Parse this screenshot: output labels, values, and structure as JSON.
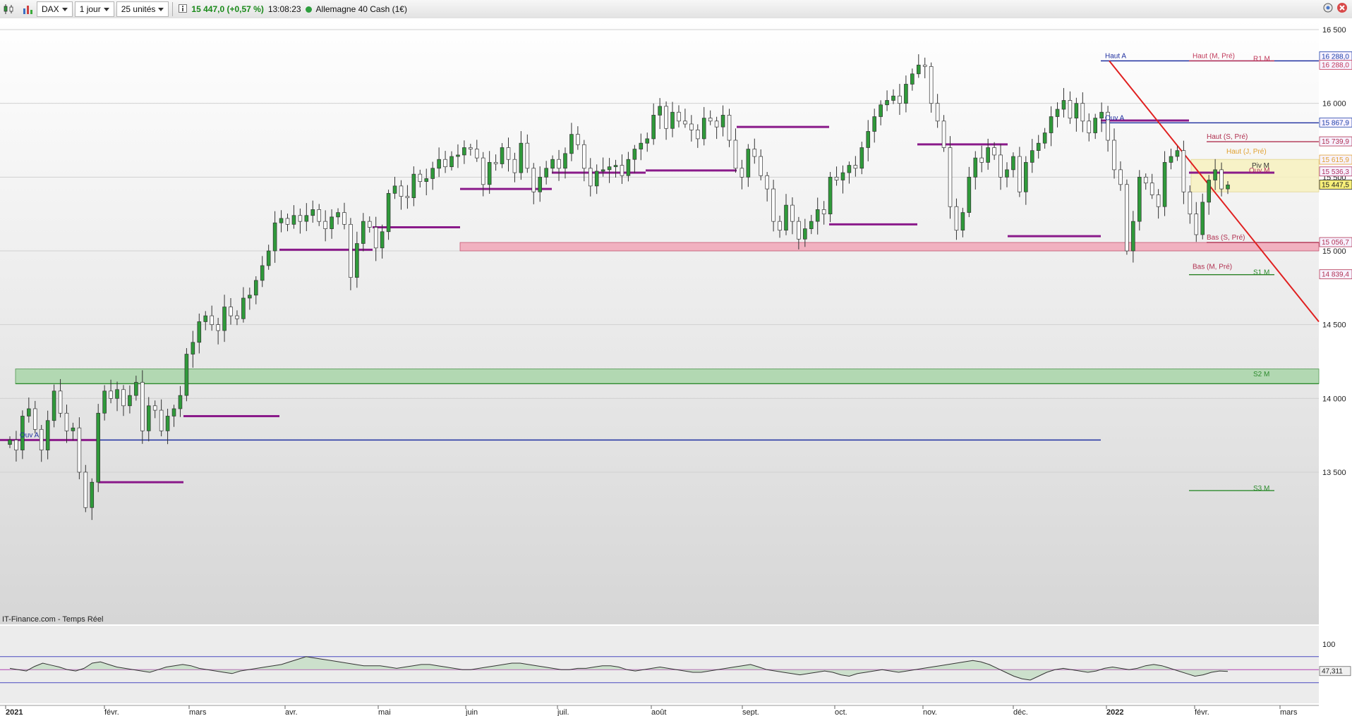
{
  "toolbar": {
    "symbol": "DAX",
    "period": "1 jour",
    "units": "25 unités",
    "quote": "15 447,0 (+0,57 %)",
    "time": "13:08:23",
    "instrument": "Allemagne 40 Cash (1€)",
    "icons": [
      "candlestick-chart-icon",
      "bar-chart-icon",
      "info-icon",
      "live-status-icon",
      "settings-icon",
      "close-icon"
    ]
  },
  "chart_data": [
    {
      "type": "candlestick",
      "ylim": [
        13500,
        16500
      ],
      "y_ticks": [
        "16 500",
        "16 000",
        "15 500",
        "15 000",
        "14 500",
        "14 000",
        "13 500"
      ],
      "x_ticks": [
        "2021",
        "févr.",
        "mars",
        "avr.",
        "mai",
        "juin",
        "juil.",
        "août",
        "sept.",
        "oct.",
        "nov.",
        "déc.",
        "2022",
        "févr.",
        "mars"
      ],
      "price_labels": [
        {
          "text": "16 288,0",
          "color": "#1f3fa8"
        },
        {
          "text": "16 288,0",
          "color": "#c0395a"
        },
        {
          "text": "15 867,9",
          "color": "#1f3fa8"
        },
        {
          "text": "15 739,9",
          "color": "#b03050"
        },
        {
          "text": "15 615,9",
          "color": "#e0a030"
        },
        {
          "text": "15 536,3",
          "color": "#b03060"
        },
        {
          "text": "15 447,5",
          "color": "#222222"
        },
        {
          "text": "15 056,7",
          "color": "#b03050"
        },
        {
          "text": "14 839,4",
          "color": "#b03050"
        }
      ],
      "annotations": [
        "Haut A",
        "Haut (M, Pré)",
        "R1 M",
        "Ouv A",
        "Haut (S, Pré)",
        "Haut (J, Pré)",
        "Piv M",
        "Ouv M",
        "Bas (S, Pré)",
        "Bas (M, Pré)",
        "S1 M",
        "S2 M",
        "S3 M",
        "Ouv A"
      ],
      "levels": [
        {
          "label": "Haut A",
          "value": 16288,
          "color": "#1f2fa0"
        },
        {
          "label": "Ouv A",
          "value": 15868,
          "color": "#1f2fa0"
        },
        {
          "label": "Ouv A 2021",
          "value": 13718,
          "color": "#1f2fa0"
        },
        {
          "label": "Haut (M, Pré)",
          "value": 16288,
          "color": "#c0395a"
        },
        {
          "label": "Haut (S, Pré)",
          "value": 15740,
          "color": "#b03050"
        },
        {
          "label": "Bas (S, Pré)",
          "value": 15057,
          "color": "#b03050"
        },
        {
          "label": "Bas (M, Pré)",
          "value": 14839,
          "color": "#b03050"
        },
        {
          "label": "S1 M",
          "value": 14839,
          "color": "#2e8b2e"
        },
        {
          "label": "S2 M",
          "value": 14100,
          "color": "#2e8b2e"
        },
        {
          "label": "S3 M",
          "value": 13375,
          "color": "#2e8b2e"
        }
      ],
      "zones": [
        {
          "from": 15000,
          "to": 15057,
          "color": "#f2a7b8"
        },
        {
          "from": 14100,
          "to": 14200,
          "color": "#a9d6a9"
        },
        {
          "from": 15400,
          "to": 15620,
          "color": "#f8f2c0"
        }
      ],
      "monthly_opens": [
        13718,
        13432,
        13880,
        15008,
        15160,
        15420,
        15530,
        15545,
        15840,
        15180,
        15722,
        15100,
        15884,
        15530,
        15540
      ],
      "trendline": {
        "from": 16288,
        "to": 14950,
        "color": "#e02020"
      },
      "close_series": [
        13718,
        13650,
        13880,
        13930,
        13790,
        13650,
        13850,
        14050,
        13900,
        13780,
        13800,
        13500,
        13260,
        13432,
        13900,
        14050,
        14000,
        14060,
        13950,
        14020,
        14109,
        13780,
        13950,
        13920,
        13780,
        13880,
        13930,
        14020,
        14300,
        14380,
        14520,
        14560,
        14500,
        14460,
        14620,
        14560,
        14540,
        14680,
        14700,
        14800,
        14900,
        15000,
        15190,
        15220,
        15180,
        15240,
        15200,
        15240,
        15280,
        15200,
        15150,
        15230,
        15260,
        15180,
        14820,
        15050,
        15200,
        15160,
        15020,
        15130,
        15390,
        15440,
        15370,
        15360,
        15520,
        15470,
        15490,
        15560,
        15620,
        15570,
        15640,
        15650,
        15700,
        15690,
        15630,
        15450,
        15600,
        15590,
        15700,
        15620,
        15530,
        15730,
        15560,
        15400,
        15500,
        15560,
        15620,
        15560,
        15660,
        15790,
        15720,
        15560,
        15440,
        15540,
        15550,
        15570,
        15580,
        15510,
        15620,
        15690,
        15730,
        15760,
        15920,
        15980,
        15830,
        15940,
        15880,
        15860,
        15820,
        15760,
        15900,
        15880,
        15840,
        15920,
        15750,
        15560,
        15500,
        15690,
        15640,
        15510,
        15420,
        15200,
        15140,
        15310,
        15200,
        15080,
        15150,
        15200,
        15280,
        15250,
        15500,
        15480,
        15530,
        15580,
        15560,
        15700,
        15810,
        15910,
        15990,
        16020,
        16050,
        16000,
        16130,
        16200,
        16260,
        16250,
        16000,
        15880,
        15700,
        15300,
        15140,
        15260,
        15500,
        15630,
        15600,
        15700,
        15650,
        15500,
        15550,
        15640,
        15400,
        15600,
        15680,
        15730,
        15800,
        15910,
        15960,
        16020,
        15900,
        16000,
        15880,
        15800,
        15900,
        15940,
        15750,
        15550,
        15450,
        15000,
        15200,
        15500,
        15460,
        15380,
        15300,
        15600,
        15640,
        15680,
        15400,
        15250,
        15110,
        15330,
        15480,
        15550,
        15420,
        15447
      ]
    },
    {
      "type": "line",
      "title": "",
      "ylim": [
        0,
        100
      ],
      "y_ticks": [
        "100"
      ],
      "value_label": "47,311",
      "reference_levels": [
        30,
        50,
        70
      ],
      "values": [
        52,
        50,
        48,
        55,
        60,
        57,
        54,
        50,
        48,
        52,
        60,
        62,
        58,
        54,
        52,
        50,
        48,
        46,
        50,
        54,
        56,
        58,
        56,
        52,
        50,
        48,
        46,
        44,
        48,
        50,
        52,
        54,
        56,
        58,
        62,
        66,
        70,
        68,
        66,
        64,
        62,
        60,
        58,
        56,
        56,
        56,
        54,
        52,
        54,
        56,
        58,
        58,
        56,
        54,
        52,
        50,
        50,
        52,
        54,
        56,
        58,
        60,
        60,
        58,
        56,
        54,
        52,
        50,
        50,
        52,
        52,
        54,
        56,
        56,
        54,
        50,
        48,
        50,
        52,
        54,
        52,
        50,
        48,
        46,
        46,
        48,
        50,
        52,
        54,
        56,
        58,
        54,
        50,
        48,
        46,
        44,
        42,
        44,
        46,
        48,
        46,
        42,
        40,
        44,
        46,
        48,
        50,
        48,
        46,
        48,
        50,
        52,
        54,
        56,
        58,
        60,
        62,
        64,
        62,
        58,
        52,
        46,
        40,
        36,
        34,
        40,
        46,
        50,
        52,
        50,
        48,
        46,
        48,
        52,
        54,
        52,
        50,
        52,
        56,
        58,
        56,
        52,
        48,
        44,
        40,
        42,
        46,
        48,
        47.311
      ]
    }
  ],
  "footer": {
    "source": "IT-Finance.com - Temps Réel"
  }
}
